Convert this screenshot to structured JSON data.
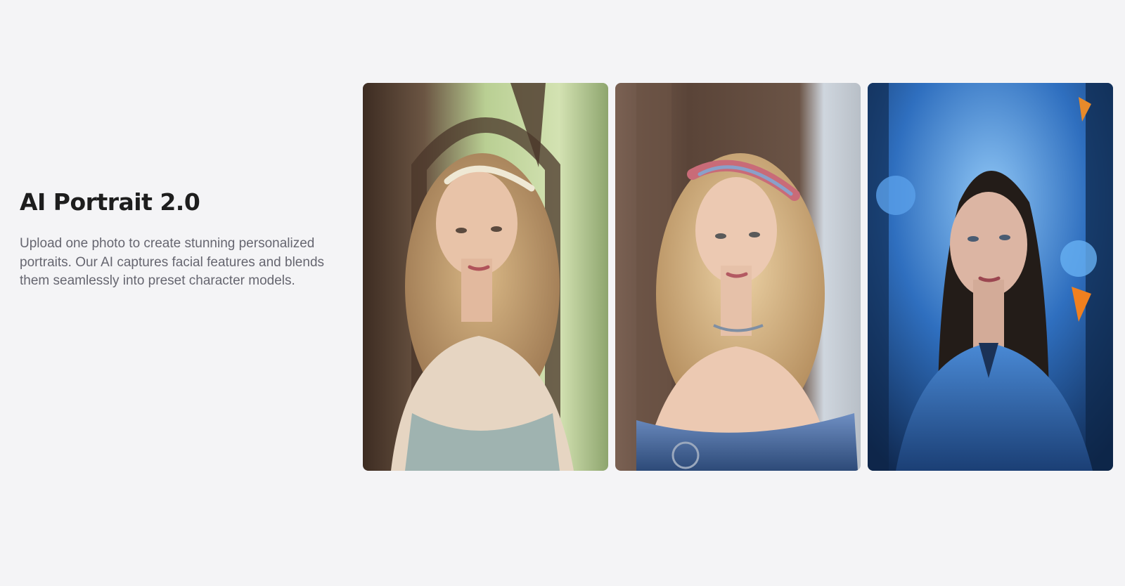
{
  "intro": {
    "title": "AI Portrait 2.0",
    "description": "Upload one photo to create stunning personalized portraits. Our AI captures facial features and blends them seamlessly into preset character models."
  },
  "gallery": {
    "items": [
      {
        "name": "portrait-fairy-garden",
        "palette": {
          "bg": "#5a4a3c",
          "light": "#c7d9a3",
          "hair": "#c8a36e",
          "skin": "#e8c3a8",
          "dress": "#9fb3b0"
        }
      },
      {
        "name": "portrait-blue-gown",
        "palette": {
          "bg": "#6b5446",
          "light": "#d9dde3",
          "hair": "#d9b98a",
          "skin": "#ecc9b2",
          "dress": "#3a5b8f"
        }
      },
      {
        "name": "portrait-blue-butterflies",
        "palette": {
          "bg": "#1d4e8f",
          "light": "#6fb3f0",
          "hair": "#2a241f",
          "skin": "#d9b3a1",
          "dress": "#2d63b0"
        }
      }
    ]
  }
}
